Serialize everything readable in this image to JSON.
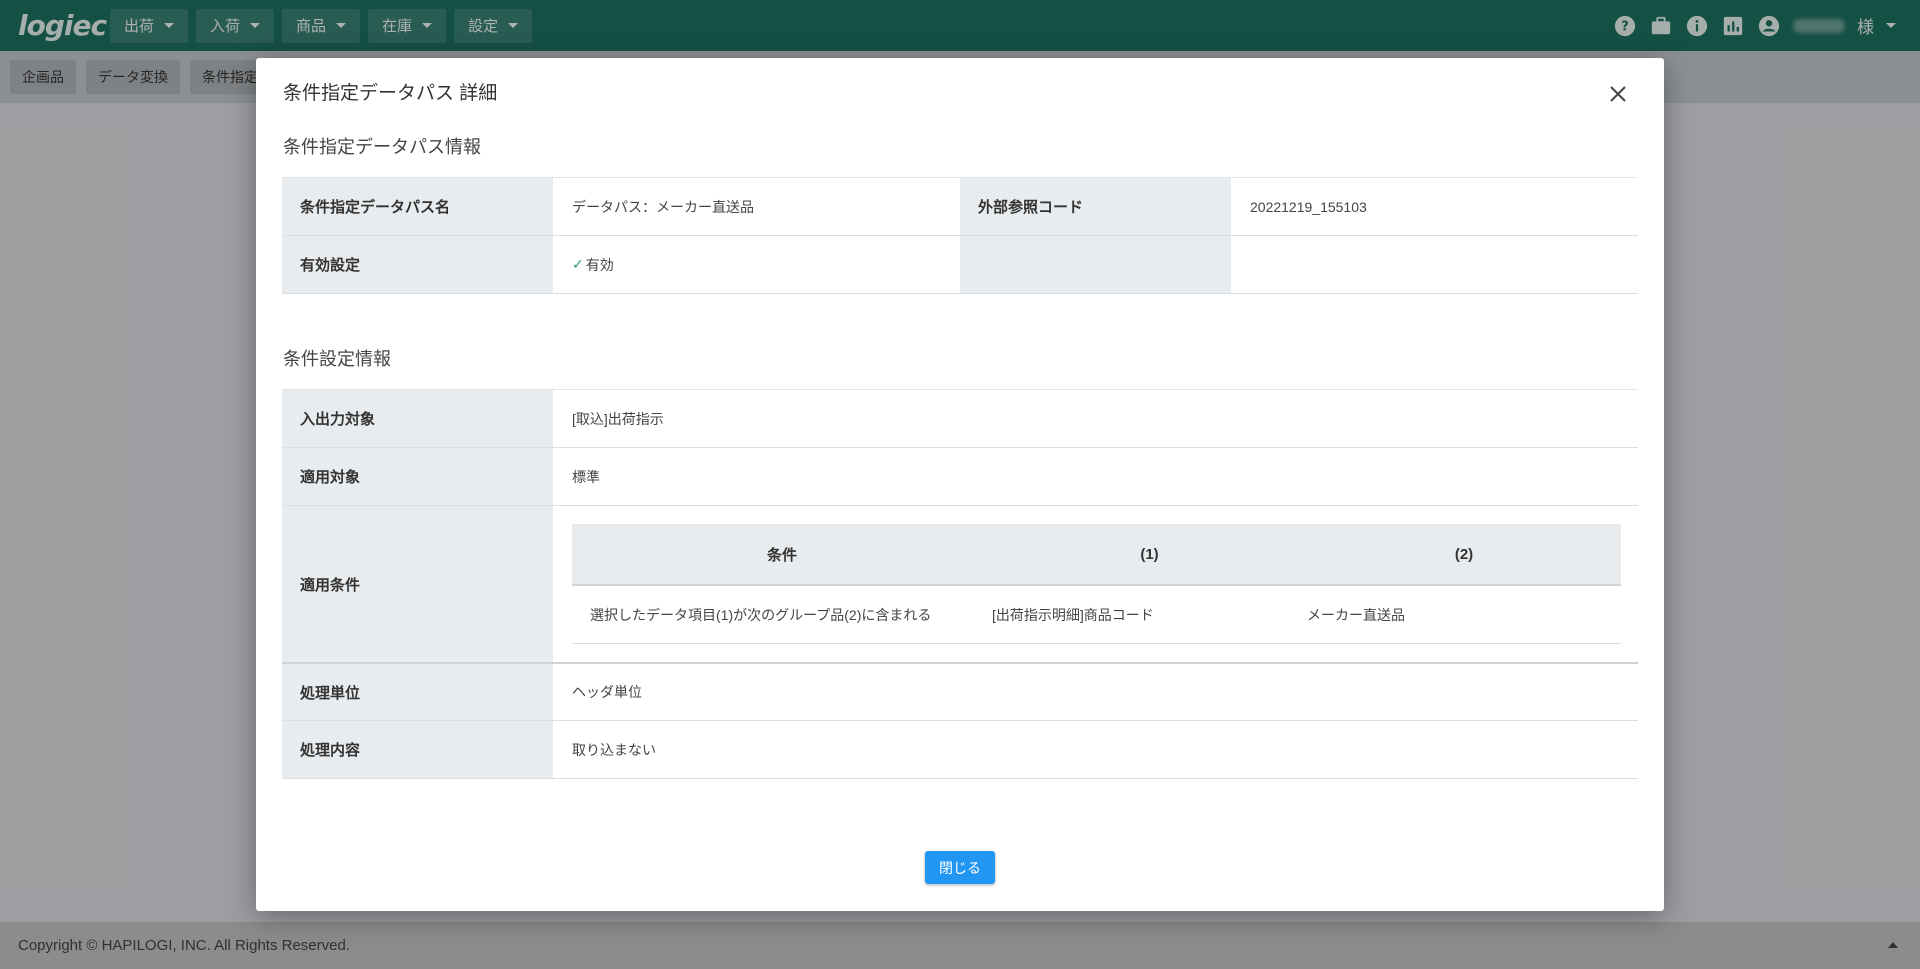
{
  "app": {
    "logo_text": "logiec",
    "user_suffix": "様"
  },
  "nav": [
    {
      "label": "出荷"
    },
    {
      "label": "入荷"
    },
    {
      "label": "商品"
    },
    {
      "label": "在庫"
    },
    {
      "label": "設定"
    }
  ],
  "top_icons": [
    "help-icon",
    "briefcase-icon",
    "info-icon",
    "chart-icon",
    "account-icon"
  ],
  "subbar": [
    {
      "label": "企画品"
    },
    {
      "label": "データ変換"
    },
    {
      "label": "条件指定"
    }
  ],
  "modal": {
    "title": "条件指定データパス 詳細",
    "section1": {
      "title": "条件指定データパス情報",
      "name_label": "条件指定データパス名",
      "name_value": "データパス：メーカー直送品",
      "extcode_label": "外部参照コード",
      "extcode_value": "20221219_155103",
      "valid_label": "有効設定",
      "valid_value": "有効"
    },
    "section2": {
      "title": "条件設定情報",
      "io_label": "入出力対象",
      "io_value": "[取込]出荷指示",
      "target_label": "適用対象",
      "target_value": "標準",
      "condition_label": "適用条件",
      "condition_table": {
        "headers": [
          "条件",
          "(1)",
          "(2)"
        ],
        "rows": [
          [
            "選択したデータ項目(1)が次のグループ品(2)に含まれる",
            "[出荷指示明細]商品コード",
            "メーカー直送品"
          ]
        ]
      },
      "unit_label": "処理単位",
      "unit_value": "ヘッダ単位",
      "content_label": "処理内容",
      "content_value": "取り込まない"
    },
    "close_button": "閉じる"
  },
  "footer": {
    "copyright": "Copyright © HAPILOGI, INC. All Rights Reserved."
  }
}
